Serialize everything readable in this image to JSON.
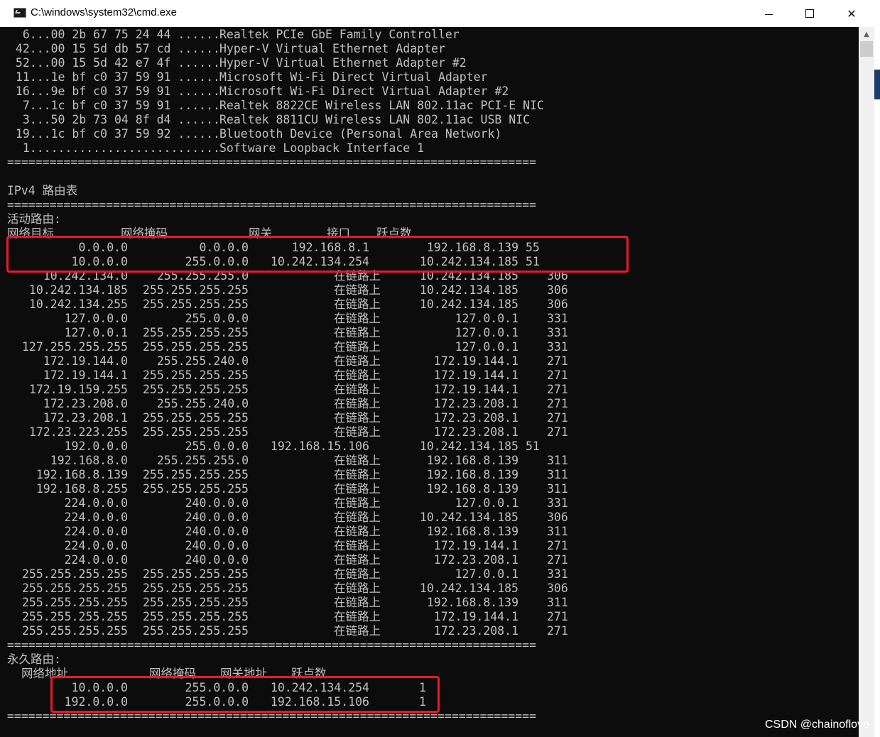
{
  "window": {
    "title": "C:\\windows\\system32\\cmd.exe",
    "icon": "cmd-app-icon",
    "controls": {
      "minimize": "minimize",
      "maximize": "maximize",
      "close": "✕"
    }
  },
  "colors": {
    "console_background": "#0c0c0c",
    "console_text": "#c0c0c0",
    "highlight_border": "#e8192c"
  },
  "interface_list": [
    {
      "prefix": " 6...00 2b 67 75 24 44 ......",
      "name": "Realtek PCIe GbE Family Controller"
    },
    {
      "prefix": "42...00 15 5d db 57 cd ......",
      "name": "Hyper-V Virtual Ethernet Adapter"
    },
    {
      "prefix": "52...00 15 5d 42 e7 4f ......",
      "name": "Hyper-V Virtual Ethernet Adapter #2"
    },
    {
      "prefix": "11...1e bf c0 37 59 91 ......",
      "name": "Microsoft Wi-Fi Direct Virtual Adapter"
    },
    {
      "prefix": "16...9e bf c0 37 59 91 ......",
      "name": "Microsoft Wi-Fi Direct Virtual Adapter #2"
    },
    {
      "prefix": " 7...1c bf c0 37 59 91 ......",
      "name": "Realtek 8822CE Wireless LAN 802.11ac PCI-E NIC"
    },
    {
      "prefix": " 3...50 2b 73 04 8f d4 ......",
      "name": "Realtek 8811CU Wireless LAN 802.11ac USB NIC"
    },
    {
      "prefix": "19...1c bf c0 37 59 92 ......",
      "name": "Bluetooth Device (Personal Area Network)"
    },
    {
      "prefix": " 1...........................",
      "name": "Software Loopback Interface 1"
    }
  ],
  "separator": "===========================================================================",
  "ipv4_title": "IPv4 路由表",
  "active_routes": {
    "label": "活动路由:",
    "headers": [
      "网络目标",
      "网络掩码",
      "网关",
      "接口",
      "跃点数"
    ],
    "rows": [
      [
        "0.0.0.0",
        "0.0.0.0",
        "192.168.8.1",
        "192.168.8.139",
        "55"
      ],
      [
        "10.0.0.0",
        "255.0.0.0",
        "10.242.134.254",
        "10.242.134.185",
        "51"
      ],
      [
        "10.242.134.0",
        "255.255.255.0",
        "在链路上",
        "10.242.134.185",
        "306"
      ],
      [
        "10.242.134.185",
        "255.255.255.255",
        "在链路上",
        "10.242.134.185",
        "306"
      ],
      [
        "10.242.134.255",
        "255.255.255.255",
        "在链路上",
        "10.242.134.185",
        "306"
      ],
      [
        "127.0.0.0",
        "255.0.0.0",
        "在链路上",
        "127.0.0.1",
        "331"
      ],
      [
        "127.0.0.1",
        "255.255.255.255",
        "在链路上",
        "127.0.0.1",
        "331"
      ],
      [
        "127.255.255.255",
        "255.255.255.255",
        "在链路上",
        "127.0.0.1",
        "331"
      ],
      [
        "172.19.144.0",
        "255.255.240.0",
        "在链路上",
        "172.19.144.1",
        "271"
      ],
      [
        "172.19.144.1",
        "255.255.255.255",
        "在链路上",
        "172.19.144.1",
        "271"
      ],
      [
        "172.19.159.255",
        "255.255.255.255",
        "在链路上",
        "172.19.144.1",
        "271"
      ],
      [
        "172.23.208.0",
        "255.255.240.0",
        "在链路上",
        "172.23.208.1",
        "271"
      ],
      [
        "172.23.208.1",
        "255.255.255.255",
        "在链路上",
        "172.23.208.1",
        "271"
      ],
      [
        "172.23.223.255",
        "255.255.255.255",
        "在链路上",
        "172.23.208.1",
        "271"
      ],
      [
        "192.0.0.0",
        "255.0.0.0",
        "192.168.15.106",
        "10.242.134.185",
        "51"
      ],
      [
        "192.168.8.0",
        "255.255.255.0",
        "在链路上",
        "192.168.8.139",
        "311"
      ],
      [
        "192.168.8.139",
        "255.255.255.255",
        "在链路上",
        "192.168.8.139",
        "311"
      ],
      [
        "192.168.8.255",
        "255.255.255.255",
        "在链路上",
        "192.168.8.139",
        "311"
      ],
      [
        "224.0.0.0",
        "240.0.0.0",
        "在链路上",
        "127.0.0.1",
        "331"
      ],
      [
        "224.0.0.0",
        "240.0.0.0",
        "在链路上",
        "10.242.134.185",
        "306"
      ],
      [
        "224.0.0.0",
        "240.0.0.0",
        "在链路上",
        "192.168.8.139",
        "311"
      ],
      [
        "224.0.0.0",
        "240.0.0.0",
        "在链路上",
        "172.19.144.1",
        "271"
      ],
      [
        "224.0.0.0",
        "240.0.0.0",
        "在链路上",
        "172.23.208.1",
        "271"
      ],
      [
        "255.255.255.255",
        "255.255.255.255",
        "在链路上",
        "127.0.0.1",
        "331"
      ],
      [
        "255.255.255.255",
        "255.255.255.255",
        "在链路上",
        "10.242.134.185",
        "306"
      ],
      [
        "255.255.255.255",
        "255.255.255.255",
        "在链路上",
        "192.168.8.139",
        "311"
      ],
      [
        "255.255.255.255",
        "255.255.255.255",
        "在链路上",
        "172.19.144.1",
        "271"
      ],
      [
        "255.255.255.255",
        "255.255.255.255",
        "在链路上",
        "172.23.208.1",
        "271"
      ]
    ]
  },
  "persistent_routes": {
    "label": "永久路由:",
    "headers": [
      "网络地址",
      "网络掩码",
      "网关地址",
      "跃点数"
    ],
    "rows": [
      [
        "10.0.0.0",
        "255.0.0.0",
        "10.242.134.254",
        "1"
      ],
      [
        "192.0.0.0",
        "255.0.0.0",
        "192.168.15.106",
        "1"
      ]
    ]
  },
  "watermark": "CSDN @chainoflove"
}
